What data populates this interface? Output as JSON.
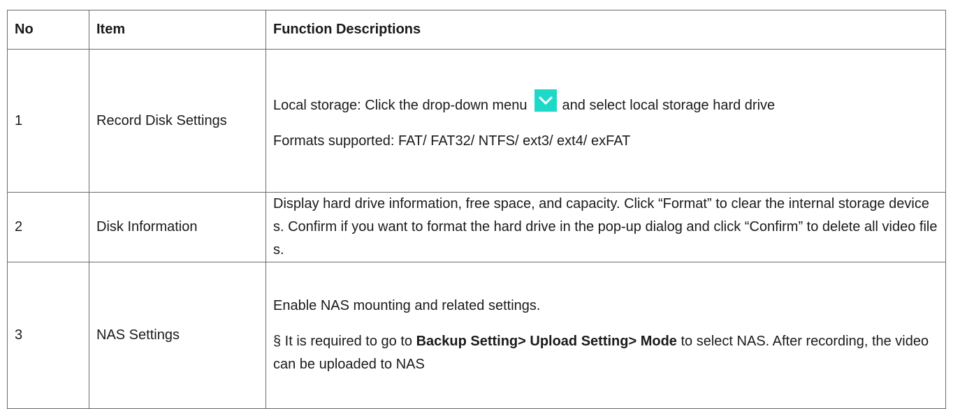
{
  "table": {
    "headers": {
      "no": "No",
      "item": "Item",
      "desc": "Function Descriptions"
    },
    "rows": [
      {
        "no": "1",
        "item": "Record Disk Settings",
        "desc_line1_pre": "Local storage: Click the drop-down menu",
        "desc_line1_post": "and select local storage hard drive",
        "desc_line2": "Formats supported: FAT/ FAT32/ NTFS/ ext3/ ext4/ exFAT",
        "icon": "chevron-down-icon"
      },
      {
        "no": "2",
        "item": "Disk Information",
        "desc": "Display hard drive information, free space, and capacity. Click “Format” to clear the internal storage devices. Confirm if you want to format the hard drive in the pop-up dialog and click “Confirm” to delete all video files."
      },
      {
        "no": "3",
        "item": "NAS Settings",
        "desc_line1": "Enable NAS mounting and related settings.",
        "desc_line2_pre": "§ It is required to go to ",
        "desc_line2_bold": "Backup Setting> Upload Setting> Mode",
        "desc_line2_post": " to select NAS. After recording, the video can be uploaded to NAS"
      }
    ]
  },
  "colors": {
    "icon_bg": "#1fd9c8",
    "border": "#6b6b6b"
  }
}
